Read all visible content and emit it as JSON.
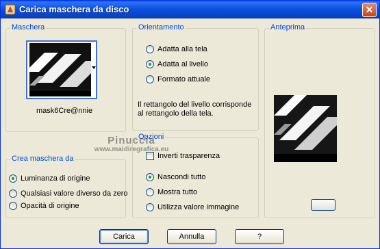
{
  "window": {
    "title": "Carica maschera da disco",
    "close_symbol": "✕"
  },
  "mask_group": {
    "legend": "Maschera",
    "mask_name": "mask6Cre@nnie"
  },
  "orientation_group": {
    "legend": "Orientamento",
    "options": [
      {
        "label": "Adatta alla tela",
        "checked": false
      },
      {
        "label": "Adatta al livello",
        "checked": true
      },
      {
        "label": "Formato attuale",
        "checked": false
      }
    ],
    "description": "Il rettangolo del livello corrisponde al rettangolo della tela."
  },
  "preview_group": {
    "legend": "Anteprima"
  },
  "options_group": {
    "legend": "Opzioni",
    "invert_label": "Inverti trasparenza",
    "invert_checked": false,
    "options": [
      {
        "label": "Nascondi tutto",
        "checked": true
      },
      {
        "label": "Mostra tutto",
        "checked": false
      },
      {
        "label": "Utilizza valore immagine",
        "checked": false
      }
    ]
  },
  "create_group": {
    "legend": "Crea maschera da",
    "options": [
      {
        "label": "Luminanza di origine",
        "checked": true
      },
      {
        "label": "Qualsiasi valore diverso da zero",
        "checked": false
      },
      {
        "label": "Opacità di origine",
        "checked": false
      }
    ]
  },
  "watermark": {
    "line1": "Pinuccia",
    "line2": "www.maidiregrafica.eu"
  },
  "buttons": {
    "load": "Carica",
    "cancel": "Annulla",
    "help": "?"
  },
  "colors": {
    "title_bar": "#0a5cf5",
    "group_legend": "#0046d5",
    "dialog_bg": "#ece9d8"
  }
}
